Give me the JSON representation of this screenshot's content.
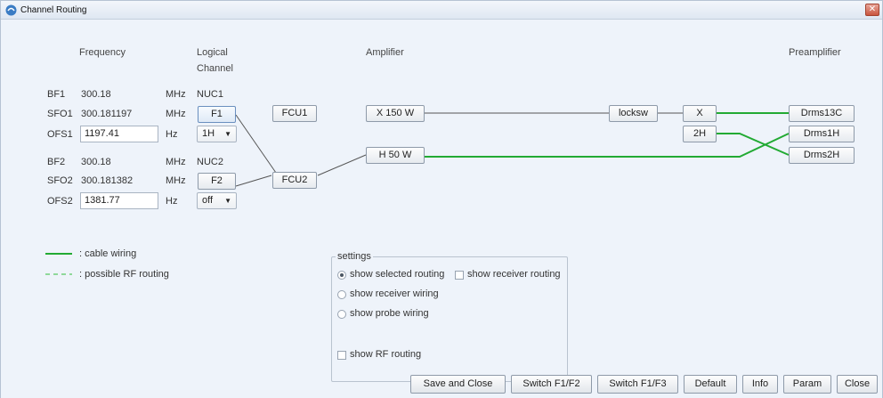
{
  "window": {
    "title": "Channel Routing",
    "close_glyph": "✕"
  },
  "headers": {
    "frequency": "Frequency",
    "logical_line1": "Logical",
    "logical_line2": "Channel",
    "amplifier": "Amplifier",
    "preamplifier": "Preamplifier"
  },
  "channels": [
    {
      "bf_label": "BF1",
      "bf_value": "300.18",
      "bf_unit": "MHz",
      "nuc": "NUC1",
      "sfo_label": "SFO1",
      "sfo_value": "300.181197",
      "sfo_unit": "MHz",
      "f_button": "F1",
      "ofs_label": "OFS1",
      "ofs_value": "1197.41",
      "ofs_unit": "Hz",
      "nucleus_select": "1H"
    },
    {
      "bf_label": "BF2",
      "bf_value": "300.18",
      "bf_unit": "MHz",
      "nuc": "NUC2",
      "sfo_label": "SFO2",
      "sfo_value": "300.181382",
      "sfo_unit": "MHz",
      "f_button": "F2",
      "ofs_label": "OFS2",
      "ofs_value": "1381.77",
      "ofs_unit": "Hz",
      "nucleus_select": "off"
    }
  ],
  "routing": {
    "fcu1": "FCU1",
    "fcu2": "FCU2",
    "amp1": "X 150 W",
    "amp2": "H 50 W",
    "locksw": "locksw",
    "x": "X",
    "h2": "2H",
    "pre1": "Drms13C",
    "pre2": "Drms1H",
    "pre3": "Drms2H"
  },
  "legend": {
    "cable": ": cable wiring",
    "rf": ": possible RF routing",
    "cable_color": "#22aa33",
    "rf_color": "#8fd89a"
  },
  "settings": {
    "title": "settings",
    "show_selected": "show selected routing",
    "show_receiver_routing": "show receiver routing",
    "show_receiver_wiring": "show receiver wiring",
    "show_probe_wiring": "show probe wiring",
    "show_rf_routing": "show RF routing",
    "selected_option": "show selected routing"
  },
  "buttons": {
    "save_close": "Save and Close",
    "switch_f2": "Switch F1/F2",
    "switch_f3": "Switch F1/F3",
    "default": "Default",
    "info": "Info",
    "param": "Param",
    "close": "Close"
  }
}
